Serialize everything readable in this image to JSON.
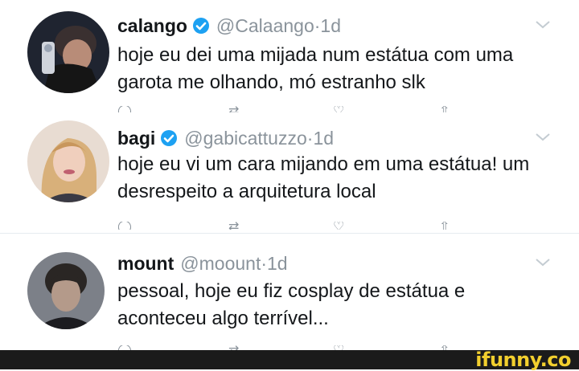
{
  "tweets": [
    {
      "name": "calango",
      "verified": true,
      "handle": "@Calaango",
      "separator": "·",
      "time": "1d",
      "text": "hoje eu dei uma mijada num estátua com uma garota me olhando, mó estranho slk"
    },
    {
      "name": "bagi",
      "verified": true,
      "handle": "@gabicattuzzo",
      "separator": "·",
      "time": "1d",
      "text": "hoje eu vi um cara mijando em uma estátua! um desrespeito a arquitetura local"
    },
    {
      "name": "mount",
      "verified": false,
      "handle": "@moount",
      "separator": "·",
      "time": "1d",
      "text": "pessoal, hoje eu fiz cosplay de estátua e aconteceu algo terrível..."
    }
  ],
  "icons": {
    "verified": "verified-badge-icon",
    "chevron": "chevron-down-icon",
    "reply": "reply-icon",
    "retweet": "retweet-icon",
    "like": "like-icon",
    "share": "share-icon"
  },
  "colors": {
    "verified": "#1da1f2",
    "muted": "#8a939b",
    "watermark": "#f2cf2e"
  },
  "watermark": "ifunny.co"
}
